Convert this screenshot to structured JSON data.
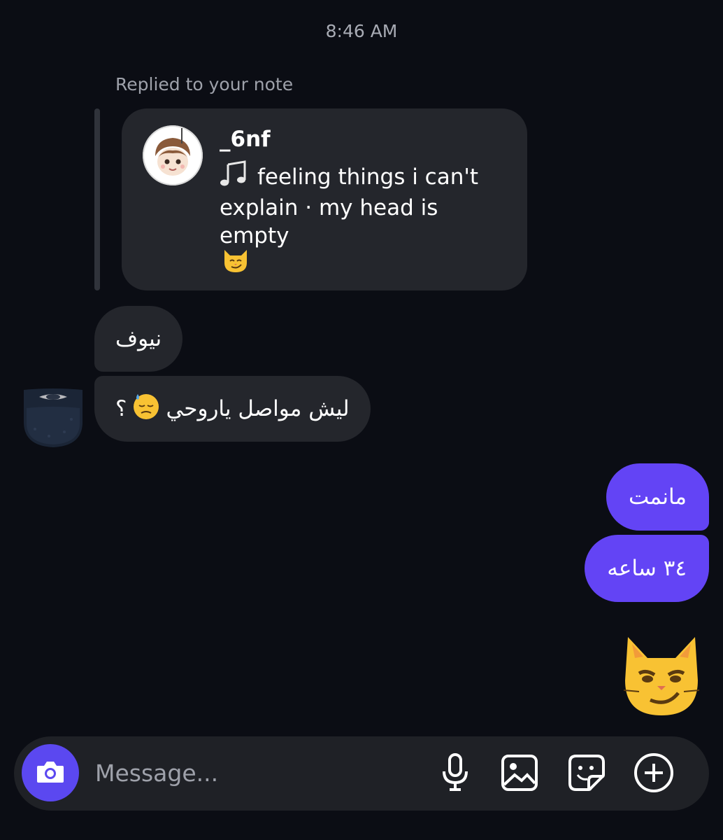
{
  "header": {
    "timestamp": "8:46 AM"
  },
  "reply": {
    "label": "Replied to your note",
    "note": {
      "username": "_6nf",
      "text": "feeling things i can't explain · my head is empty",
      "music_icon": "music-note-icon",
      "emoji": "smirking-cat-emoji"
    }
  },
  "messages": {
    "incoming": [
      {
        "text": "نيوف"
      },
      {
        "text": "ليش مواصل ياروحي",
        "suffix": "؟",
        "emoji": "downcast-sweat-face-emoji"
      }
    ],
    "outgoing": [
      {
        "text": "مانمت"
      },
      {
        "text": "٣٤ ساعه"
      }
    ],
    "sticker": "smirking-cat-emoji"
  },
  "composer": {
    "placeholder": "Message...",
    "icons": [
      "camera-icon",
      "microphone-icon",
      "gallery-icon",
      "sticker-icon",
      "plus-circle-icon"
    ]
  },
  "colors": {
    "background": "#0b0d14",
    "incoming_bubble": "#24262c",
    "outgoing_bubble": "#6344f5",
    "camera_button": "#5b48f0"
  }
}
